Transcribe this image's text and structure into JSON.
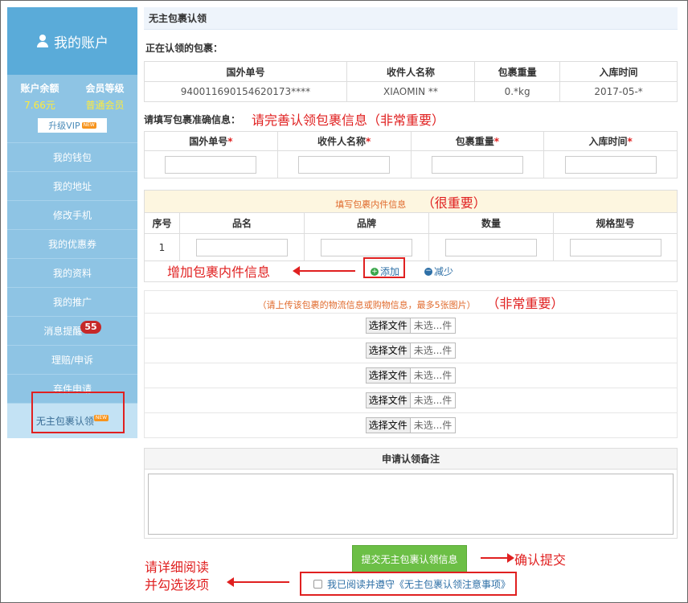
{
  "sidebar": {
    "title": "我的账户",
    "balance_label": "账户余额",
    "balance_value": "7.66元",
    "level_label": "会员等级",
    "level_value": "普通会员",
    "vip_label": "升级VIP",
    "new_tag": "NEW",
    "badge_count": "55",
    "items": [
      {
        "label": "我的钱包"
      },
      {
        "label": "我的地址"
      },
      {
        "label": "修改手机"
      },
      {
        "label": "我的优惠券"
      },
      {
        "label": "我的资料"
      },
      {
        "label": "我的推广"
      },
      {
        "label": "消息提醒"
      },
      {
        "label": "理赔/申诉"
      },
      {
        "label": "弃件申请"
      },
      {
        "label": "无主包裹认领"
      }
    ]
  },
  "main": {
    "title": "无主包裹认领",
    "current_label": "正在认领的包裹：",
    "claim_table": {
      "headers": [
        "国外单号",
        "收件人名称",
        "包裹重量",
        "入库时间"
      ],
      "row": [
        "940011690154620173****",
        "XIAOMIN **",
        "0.*kg",
        "2017-05-*"
      ]
    },
    "fill_label": "请填写包裹准确信息：",
    "fill_annotation": "请完善认领包裹信息（非常重要）",
    "fill_headers": [
      "国外单号",
      "收件人名称",
      "包裹重量",
      "入库时间"
    ],
    "required_mark": "*",
    "contents_header": "填写包裹内件信息",
    "contents_annotation": "（很重要）",
    "contents_columns": [
      "序号",
      "品名",
      "品牌",
      "数量",
      "规格型号"
    ],
    "contents_row_index": "1",
    "add_label": "添加",
    "remove_label": "减少",
    "add_annotation": "增加包裹内件信息",
    "upload_header": "（请上传该包裹的物流信息或购物信息，最多5张图片）",
    "upload_annotation": "（非常重要）",
    "file_button": "选择文件",
    "file_placeholder": "未选...件",
    "remark_header": "申请认领备注",
    "submit_label": "提交无主包裹认领信息",
    "submit_annotation": "确认提交",
    "agree_text": "我已阅读并遵守《无主包裹认领注意事项》",
    "agree_annotation_line1": "请详细阅读",
    "agree_annotation_line2": "并勾选该项"
  }
}
